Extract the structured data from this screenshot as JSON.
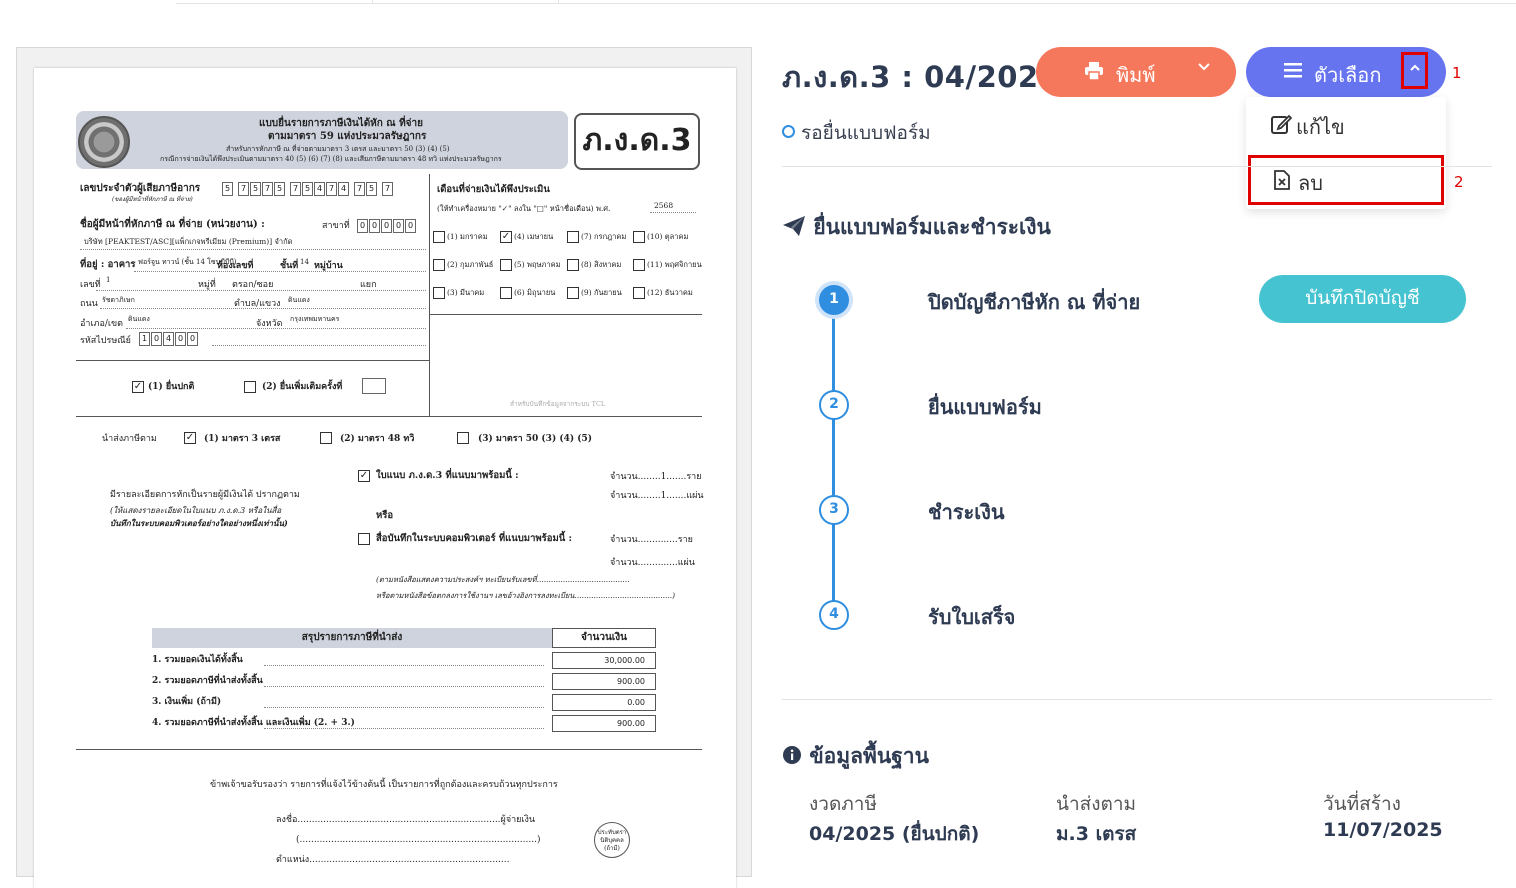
{
  "document": {
    "header_line1": "แบบยื่นรายการภาษีเงินได้หัก ณ ที่จ่าย",
    "header_line2": "ตามมาตรา 59 แห่งประมวลรัษฎากร",
    "header_line3": "สำหรับการหักภาษี ณ ที่จ่ายตามมาตรา 3 เตรส และมาตรา 50 (3) (4) (5)",
    "header_line4": "กรณีการจ่ายเงินได้พึงประเมินตามมาตรา 40 (5) (6) (7) (8) และเสียภาษีตามมาตรา 48 ทวิ แห่งประมวลรัษฎากร",
    "form_code": "ภ.ง.ด.3",
    "taxid_label": "เลขประจำตัวผู้เสียภาษีอากร",
    "taxid_sub": "(ของผู้มีหน้าที่หักภาษี ณ ที่จ่าย)",
    "taxid_digits": [
      "5",
      "7",
      "5",
      "7",
      "5",
      "7",
      "5",
      "4",
      "7",
      "4",
      "7",
      "5",
      "7"
    ],
    "payer_label": "ชื่อผู้มีหน้าที่หักภาษี ณ ที่จ่าย (หน่วยงาน) :",
    "branch_label": "สาขาที่",
    "branch_digits": [
      "0",
      "0",
      "0",
      "0",
      "0"
    ],
    "company": "บริษัท [PEAKTEST/ASC][แพ็กเกจพรีเมียม (Premium)] จำกัด",
    "address_label": "ที่อยู่ : อาคาร",
    "building": "ฟอร์จูน ทาวน์ (ชั้น 14 โซนบีบีบี)",
    "room_label": "ห้องเลขที่",
    "floor_label": "ชั้นที่",
    "floor": "14",
    "village_label": "หมู่บ้าน",
    "no_label": "เลขที่",
    "no": "1",
    "moo_label": "หมู่ที่",
    "soi_label": "ตรอก/ซอย",
    "yaek_label": "แยก",
    "road_label": "ถนน",
    "road": "รัชดาภิเษก",
    "subdistrict_label": "ตำบล/แขวง",
    "subdistrict": "ดินแดง",
    "district_label": "อำเภอ/เขต",
    "district": "ดินแดง",
    "province_label": "จังหวัด",
    "province": "กรุงเทพมหานคร",
    "postcode_label": "รหัสไปรษณีย์",
    "postcode_digits": [
      "1",
      "0",
      "4",
      "0",
      "0"
    ],
    "month_label": "เดือนที่จ่ายเงินได้พึงประเมิน",
    "month_hint": "(ให้ทำเครื่องหมาย \"✓\" ลงใน \"□\" หน้าชื่อเดือน) พ.ศ.",
    "year": "2568",
    "months": [
      "(1) มกราคม",
      "(2) กุมภาพันธ์",
      "(3) มีนาคม",
      "(4) เมษายน",
      "(5) พฤษภาคม",
      "(6) มิถุนายน",
      "(7) กรกฎาคม",
      "(8) สิงหาคม",
      "(9) กันยายน",
      "(10) ตุลาคม",
      "(11) พฤศจิกายน",
      "(12) ธันวาคม"
    ],
    "checked_month": "(4) เมษายน",
    "filing_normal": "(1) ยื่นปกติ",
    "filing_extra": "(2)   ยื่นเพิ่มเติมครั้งที่",
    "system_note": "สำหรับบันทึกข้อมูลจากระบบ TCL",
    "submit_label": "นำส่งภาษีตาม",
    "submit_opt1": "(1)  มาตรา 3 เตรส",
    "submit_opt2": "(2)  มาตรา 48 ทวิ",
    "submit_opt3": "(3)  มาตรา 50 (3) (4) (5)",
    "attach_label": "ใบแนบ ภ.ง.ด.3 ที่แนบมาพร้อมนี้ :",
    "amount_people": "จำนวน........1.......ราย",
    "amount_sheets": "จำนวน........1.......แผ่น",
    "amount_people_empty": "จำนวน..............ราย",
    "amount_sheets_empty": "จำนวน..............แผ่น",
    "detail_line1": "มีรายละเอียดการหักเป็นรายผู้มีเงินได้ ปรากฏตาม",
    "detail_line2": "(ให้แสดงรายละเอียดในใบแนบ ภ.ง.ด.3 หรือในสื่อ",
    "detail_line3": "บันทึกในระบบคอมพิวเตอร์อย่างใดอย่างหนึ่งเท่านั้น)",
    "or_label": "หรือ",
    "media_label": "สื่อบันทึกในระบบคอมพิวเตอร์ ที่แนบมาพร้อมนี้ :",
    "media_note1": "(ตามหนังสือแสดงความประสงค์ฯ ทะเบียนรับเลขที่.......................................",
    "media_note2": "หรือตามหนังสือข้อตกลงการใช้งานฯ เลขอ้างอิงการลงทะเบียน.........................................)",
    "summary_head": "สรุปรายการภาษีที่นำส่ง",
    "amount_head": "จำนวนเงิน",
    "summary_rows": [
      {
        "label": "1. รวมยอดเงินได้ทั้งสิ้น",
        "value": "30,000.00"
      },
      {
        "label": "2. รวมยอดภาษีที่นำส่งทั้งสิ้น",
        "value": "900.00"
      },
      {
        "label": "3. เงินเพิ่ม (ถ้ามี)",
        "value": "0.00"
      },
      {
        "label": "4. รวมยอดภาษีที่นำส่งทั้งสิ้น และเงินเพิ่ม (2. + 3.)",
        "value": "900.00"
      }
    ],
    "certify": "ข้าพเจ้าขอรับรองว่า รายการที่แจ้งไว้ข้างต้นนี้ เป็นรายการที่ถูกต้องและครบถ้วนทุกประการ",
    "sign_label": "ลงชื่อ.......................................................................ผู้จ่ายเงิน",
    "sign_paren": "(...................................................................................)",
    "position_label": "ตำแหน่ง......................................................................",
    "stamp_text": "ประทับตรา นิติบุคคล (ถ้ามี)"
  },
  "header": {
    "title": "ภ.ง.ด.3 : 04/2025",
    "print_label": "พิมพ์",
    "options_label": "ตัวเลือก",
    "annotation_1": "1",
    "annotation_2": "2"
  },
  "dropdown": {
    "edit_label": "แก้ไข",
    "delete_label": "ลบ"
  },
  "status": "รอยื่นแบบฟอร์ม",
  "process": {
    "title": "ยื่นแบบฟอร์มและชำระเงิน",
    "steps": [
      {
        "num": "1",
        "label": "ปิดบัญชีภาษีหัก ณ ที่จ่าย"
      },
      {
        "num": "2",
        "label": "ยื่นแบบฟอร์ม"
      },
      {
        "num": "3",
        "label": "ชำระเงิน"
      },
      {
        "num": "4",
        "label": "รับใบเสร็จ"
      }
    ],
    "close_button": "บันทึกปิดบัญชี"
  },
  "info": {
    "title": "ข้อมูลพื้นฐาน",
    "period_label": "งวดภาษี",
    "period_value": "04/2025 (ยื่นปกติ)",
    "submit_label": "นำส่งตาม",
    "submit_value": "ม.3 เตรส",
    "created_label": "วันที่สร้าง",
    "created_value": "11/07/2025"
  },
  "colors": {
    "print_button": "#f5785c",
    "options_button": "#6774f0",
    "close_button": "#45c3d0",
    "step_accent": "#2f8ee0",
    "annotation": "#e00000"
  }
}
